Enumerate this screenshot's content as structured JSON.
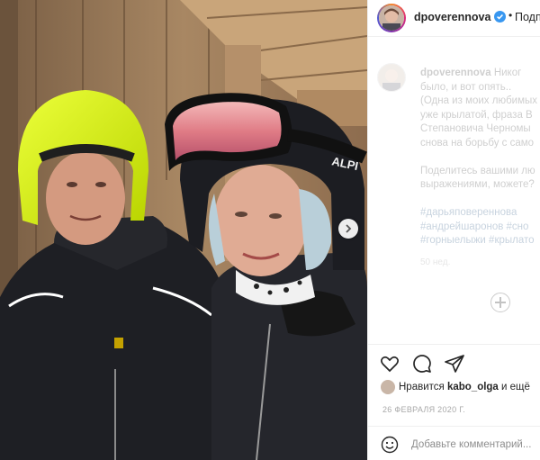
{
  "post": {
    "username": "dpoverennova",
    "follow_label": "Подп",
    "dot": "•",
    "caption_lines": [
      "Никог",
      "было, и вот опять..",
      "(Одна из моих любимых",
      "уже крылатой, фраза В",
      "Степановича Черномы",
      "снова на борьбу с само"
    ],
    "caption_question_lines": [
      "Поделитесь вашими лю",
      "выражениями, можете?"
    ],
    "hashtags": [
      "#дарьяповереннова",
      "#андрейшаронов #сно",
      "#горныелыжи #крылато"
    ],
    "post_age": "50 нед.",
    "likes_prefix": "Нравится",
    "likes_user": "kabo_olga",
    "likes_suffix": "и ещё",
    "date": "26 ФЕВРАЛЯ 2020 Г.",
    "comment_placeholder": "Добавьте комментарий..."
  },
  "photo": {
    "helmet_text": "ALPI"
  },
  "icons": [
    "verified-badge-icon",
    "chevron-right-icon",
    "heart-icon",
    "comment-icon",
    "share-icon",
    "emoji-icon",
    "plus-circle-icon"
  ],
  "colors": {
    "verified": "#3897f0",
    "hashtag": "#00376b",
    "helmet_yellow": "#d6f000"
  }
}
